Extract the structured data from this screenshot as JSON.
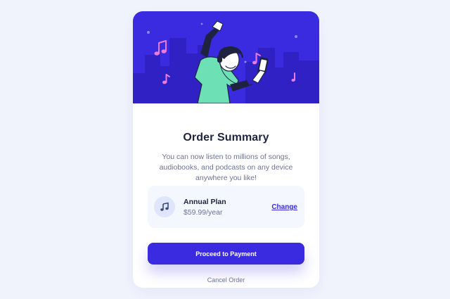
{
  "card": {
    "title": "Order Summary",
    "description": "You can now listen to millions of songs, audiobooks, and podcasts on any device anywhere you like!"
  },
  "plan": {
    "icon": "music-note-icon",
    "name": "Annual Plan",
    "price": "$59.99/year",
    "change_label": "Change"
  },
  "actions": {
    "proceed_label": "Proceed to Payment",
    "cancel_label": "Cancel Order"
  },
  "colors": {
    "page_background": "#f1f3fc",
    "brand": "#3a2be0",
    "hero_background": "#3a2be0",
    "heading": "#1f2340",
    "body_text": "#6e7296",
    "plan_background": "#f5f7ff",
    "accent_pink": "#e87ae0",
    "figure_green": "#6de0b6"
  }
}
